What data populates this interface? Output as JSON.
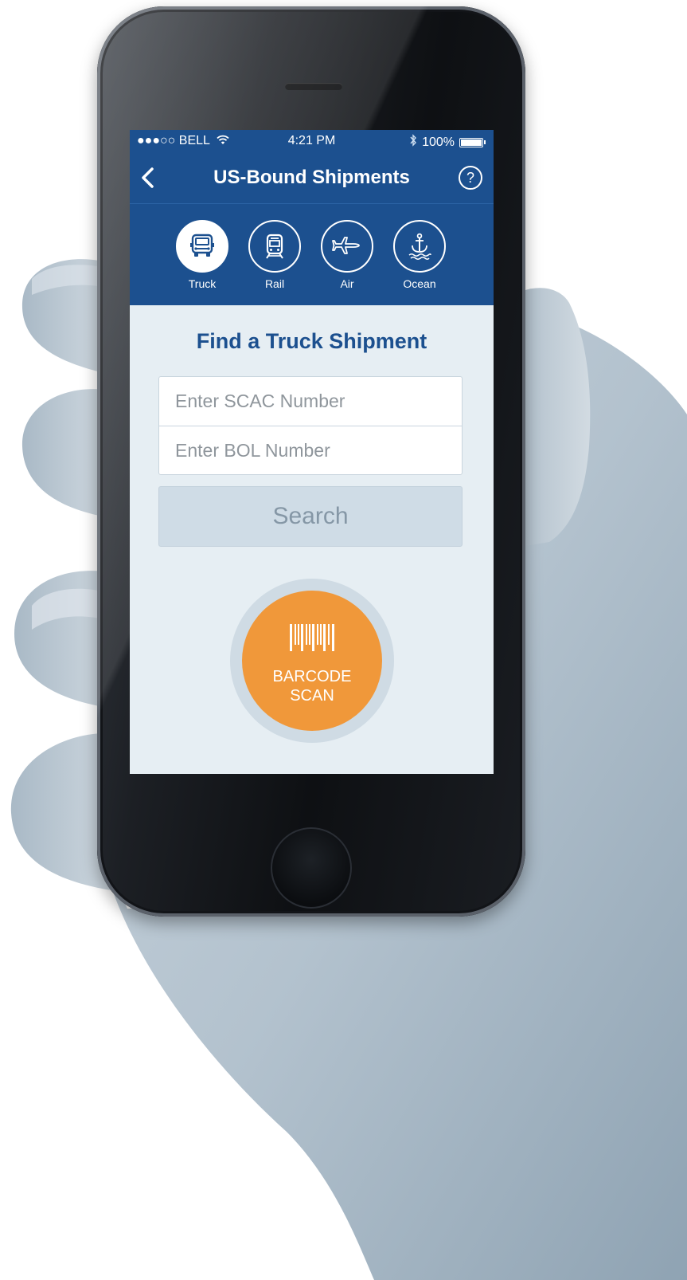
{
  "status_bar": {
    "carrier": "●●●○○ BELL",
    "time": "4:21 PM",
    "battery": "100%"
  },
  "nav": {
    "title": "US-Bound Shipments",
    "help": "?"
  },
  "modes": [
    {
      "label": "Truck",
      "icon": "truck-icon",
      "active": true
    },
    {
      "label": "Rail",
      "icon": "train-icon",
      "active": false
    },
    {
      "label": "Air",
      "icon": "airplane-icon",
      "active": false
    },
    {
      "label": "Ocean",
      "icon": "anchor-icon",
      "active": false
    }
  ],
  "form": {
    "title": "Find a Truck Shipment",
    "scac_placeholder": "Enter SCAC Number",
    "bol_placeholder": "Enter BOL Number",
    "search_label": "Search"
  },
  "barcode": {
    "line1": "BARCODE",
    "line2": "SCAN"
  },
  "colors": {
    "header_blue": "#1c508f",
    "accent_orange": "#f0983a",
    "screen_bg": "#e6eef3"
  }
}
